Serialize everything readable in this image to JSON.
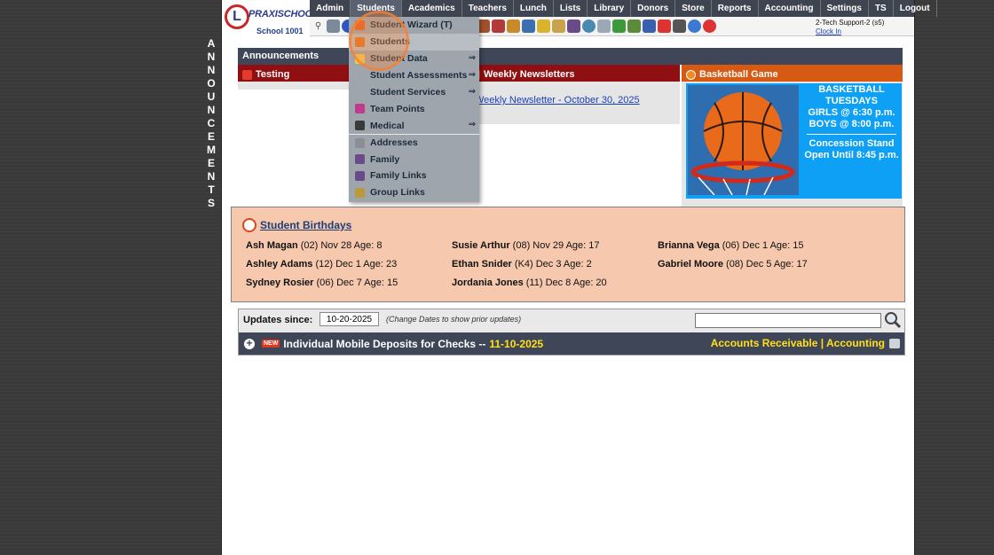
{
  "logo": {
    "mark": "L",
    "name": "PRAXISCHOOL",
    "tm": "™",
    "school": "School 1001"
  },
  "menu": [
    "Admin",
    "Students",
    "Academics",
    "Teachers",
    "Lunch",
    "Lists",
    "Library",
    "Donors",
    "Store",
    "Reports",
    "Accounting",
    "Settings",
    "TS",
    "Logout"
  ],
  "user": {
    "name": "2-Tech Support-2 (s5)",
    "clock": "Clock In"
  },
  "vertical_letters": [
    "A",
    "N",
    "N",
    "O",
    "U",
    "N",
    "C",
    "E",
    "M",
    "E",
    "N",
    "T",
    "S"
  ],
  "announcements": {
    "header": "Announcements",
    "cards": [
      {
        "title": "Testing"
      },
      {
        "title": "Weekly Newsletters",
        "link": "Weekly Newsletter - October 30, 2025"
      },
      {
        "title": "Basketball Game",
        "lines": [
          "BASKETBALL",
          "TUESDAYS",
          "GIRLS @ 6:30 p.m.",
          "BOYS  @ 8:00 p.m."
        ],
        "lines2": [
          "Concession Stand",
          "Open Until 8:45 p.m."
        ]
      }
    ]
  },
  "dropdown": [
    {
      "label": "Student Wizard (T)",
      "icon_color": "#e85a1e",
      "arrow": ""
    },
    {
      "label": "Students",
      "icon_color": "#e07020",
      "arrow": ""
    },
    {
      "label": "Student Data",
      "icon_color": "#f2c94c",
      "arrow": "⇒"
    },
    {
      "label": "Student Assessments",
      "icon_color": "",
      "arrow": "⇒"
    },
    {
      "label": "Student Services",
      "icon_color": "",
      "arrow": "⇒"
    },
    {
      "label": "Team Points",
      "icon_color": "#c0398c",
      "arrow": ""
    },
    {
      "label": "Medical",
      "icon_color": "#3a3a3a",
      "arrow": "⇒"
    },
    {
      "label": "Addresses",
      "icon_color": "#8a8f96",
      "arrow": ""
    },
    {
      "label": "Family",
      "icon_color": "#6a4a8a",
      "arrow": ""
    },
    {
      "label": "Family Links",
      "icon_color": "#6a4a8a",
      "arrow": ""
    },
    {
      "label": "Group Links",
      "icon_color": "#b99a3a",
      "arrow": ""
    }
  ],
  "birthdays": {
    "title": "Student Birthdays",
    "rows": [
      {
        "name": "Ash Magan",
        "rest": "(02) Nov 28 Age: 8"
      },
      {
        "name": "Susie Arthur",
        "rest": "(08) Nov 29 Age: 17"
      },
      {
        "name": "Brianna Vega",
        "rest": "(06) Dec 1 Age: 15"
      },
      {
        "name": "Ashley Adams",
        "rest": "(12) Dec 1 Age: 23"
      },
      {
        "name": "Ethan Snider",
        "rest": "(K4) Dec 3 Age: 2"
      },
      {
        "name": "Gabriel Moore",
        "rest": "(08) Dec 5 Age: 17"
      },
      {
        "name": "Sydney Rosier",
        "rest": "(06) Dec 7 Age: 15"
      },
      {
        "name": "Jordania Jones",
        "rest": "(11) Dec 8 Age: 20"
      }
    ]
  },
  "updates": {
    "label": "Updates since:",
    "date": "10-20-2025",
    "note": "(Change Dates to show prior updates)",
    "search_value": "",
    "new_badge": "NEW",
    "item_title": "Individual Mobile Deposits for Checks --",
    "item_date": "11-10-2025",
    "links": "Accounts Receivable | Accounting"
  },
  "colors": {
    "menubar": "#3f4550",
    "header": "#3e4658",
    "red": "#8f0f12",
    "orange": "#d65a13",
    "birthday_bg": "#f6c8ad",
    "highlight_yellow": "#ffe01a"
  }
}
